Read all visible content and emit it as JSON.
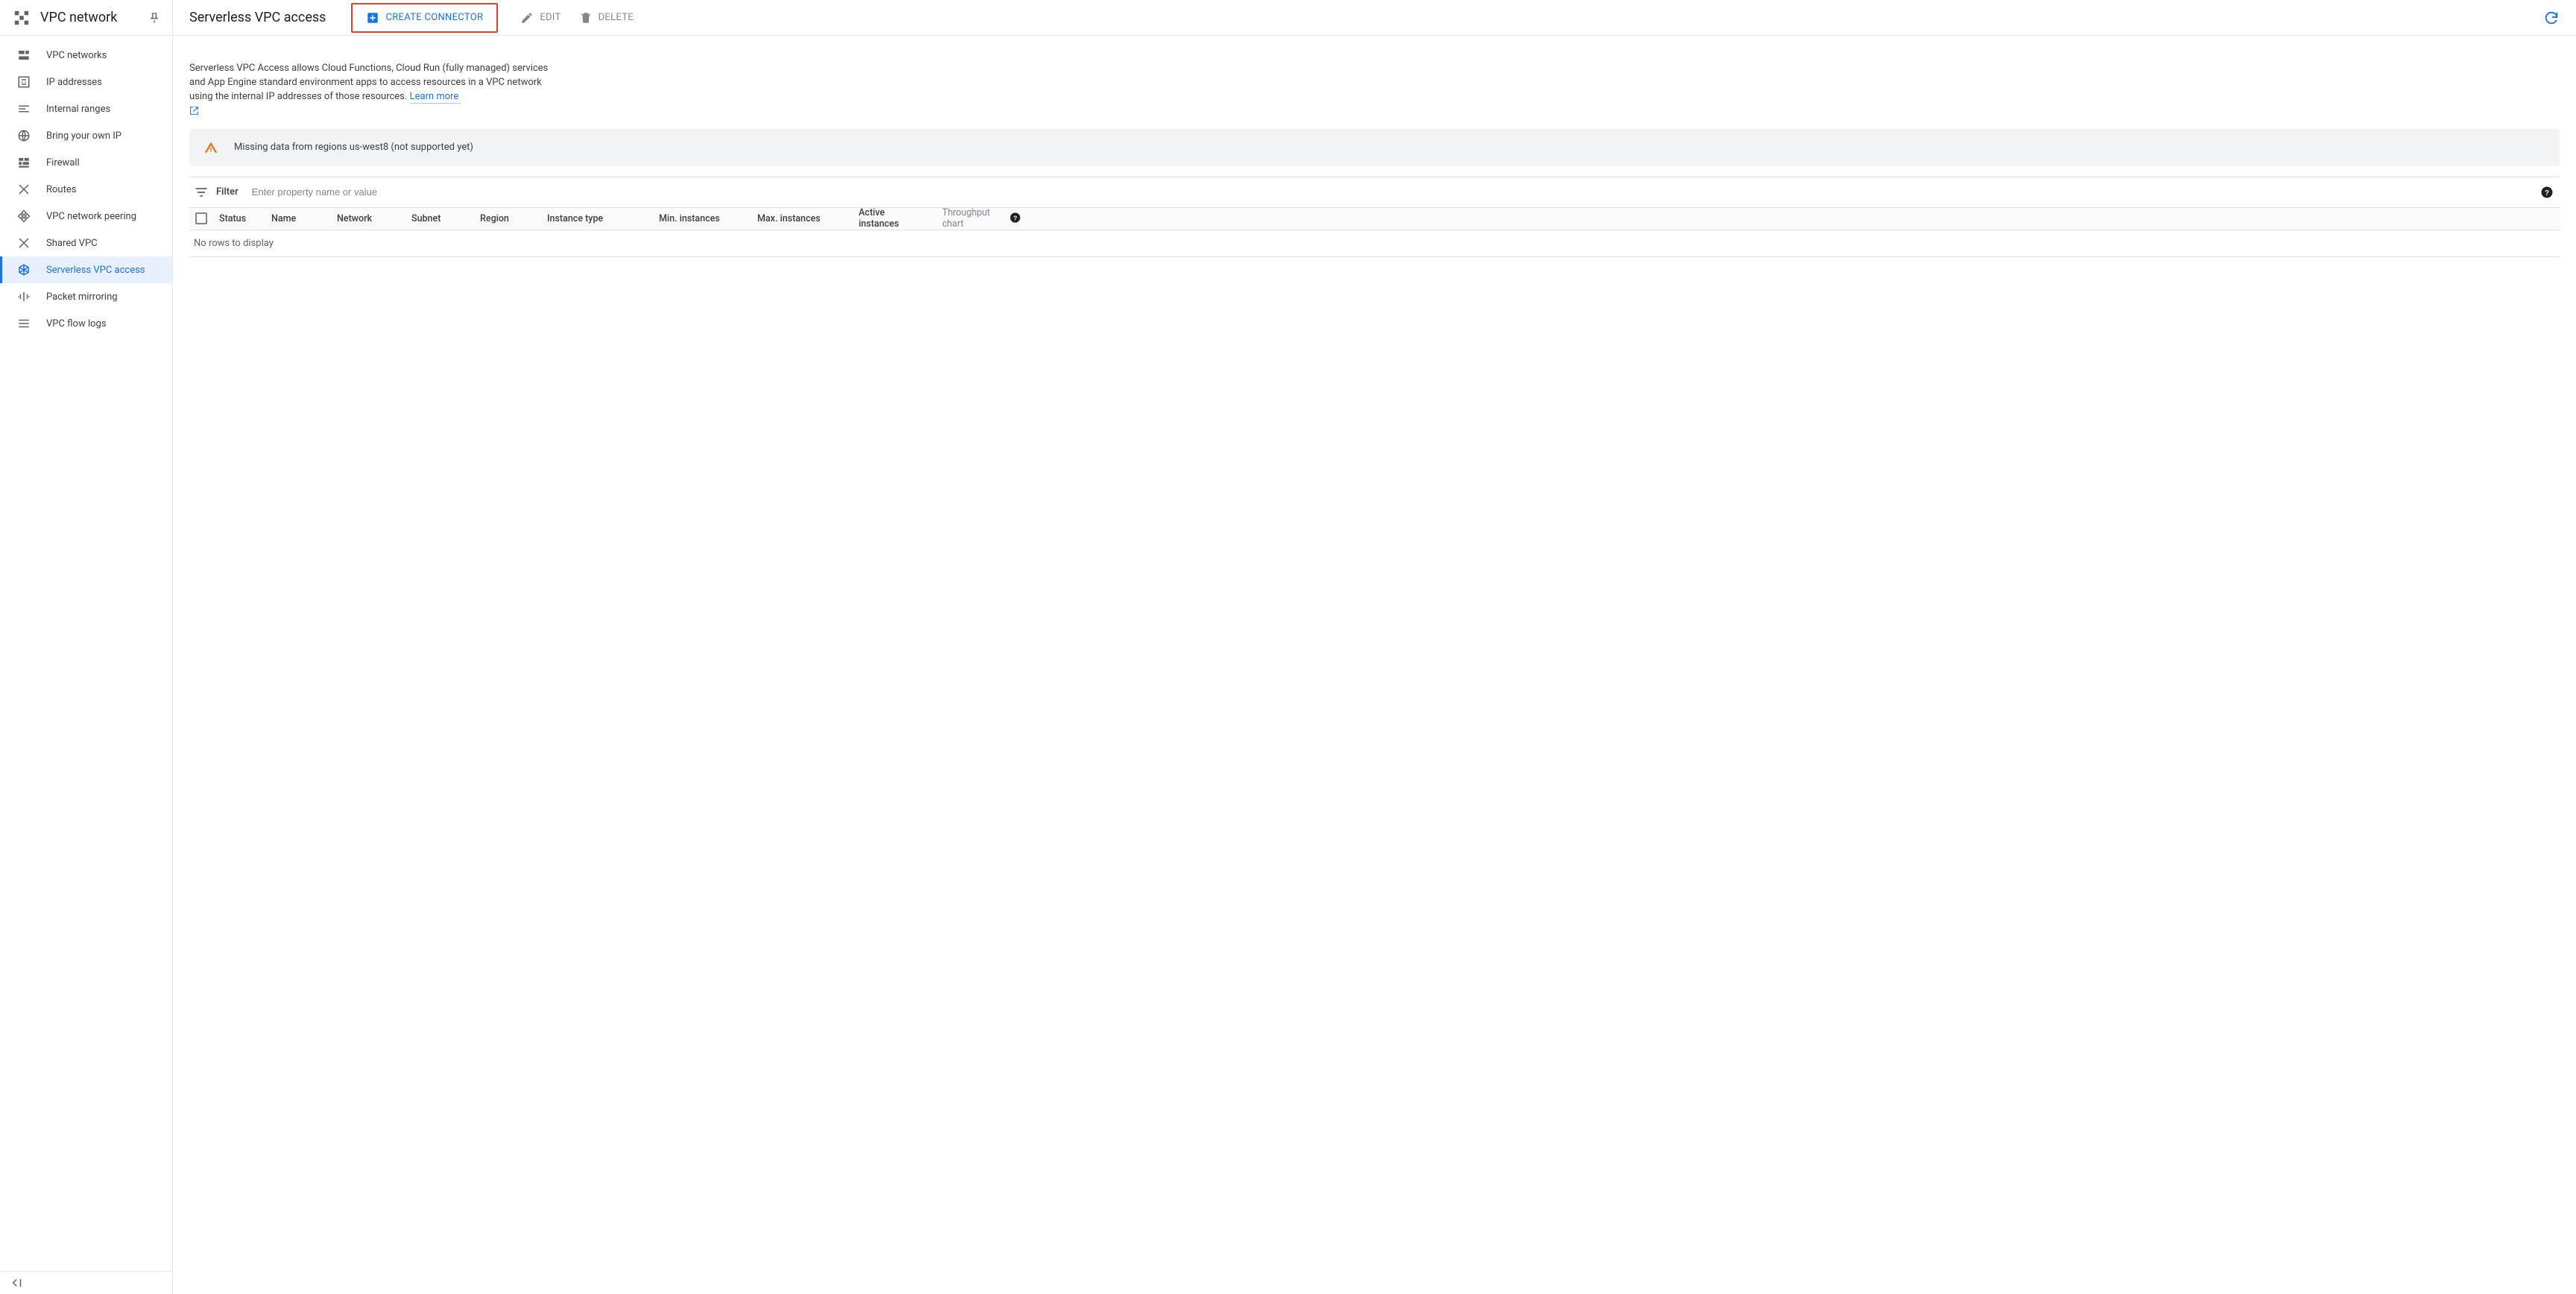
{
  "sidebar": {
    "title": "VPC network",
    "items": [
      {
        "label": "VPC networks",
        "icon": "subnets"
      },
      {
        "label": "IP addresses",
        "icon": "ip"
      },
      {
        "label": "Internal ranges",
        "icon": "ranges"
      },
      {
        "label": "Bring your own IP",
        "icon": "globe"
      },
      {
        "label": "Firewall",
        "icon": "firewall"
      },
      {
        "label": "Routes",
        "icon": "routes"
      },
      {
        "label": "VPC network peering",
        "icon": "peering"
      },
      {
        "label": "Shared VPC",
        "icon": "shared"
      },
      {
        "label": "Serverless VPC access",
        "icon": "serverless",
        "selected": true
      },
      {
        "label": "Packet mirroring",
        "icon": "mirroring"
      },
      {
        "label": "VPC flow logs",
        "icon": "flowlogs"
      }
    ]
  },
  "toolbar": {
    "page_title": "Serverless VPC access",
    "create_label": "Create Connector",
    "edit_label": "Edit",
    "delete_label": "Delete"
  },
  "description": {
    "text": "Serverless VPC Access allows Cloud Functions, Cloud Run (fully managed) services and App Engine standard environment apps to access resources in a VPC network using the internal IP addresses of those resources.",
    "learn_more": "Learn more"
  },
  "banner": {
    "text": "Missing data from regions us-west8 (not supported yet)"
  },
  "filter": {
    "label": "Filter",
    "placeholder": "Enter property name or value"
  },
  "table": {
    "columns": {
      "status": "Status",
      "name": "Name",
      "network": "Network",
      "subnet": "Subnet",
      "region": "Region",
      "instance_type": "Instance type",
      "min_instances": "Min. instances",
      "max_instances": "Max. instances",
      "active_instances": "Active instances",
      "throughput_chart": "Throughput chart"
    },
    "empty": "No rows to display"
  }
}
